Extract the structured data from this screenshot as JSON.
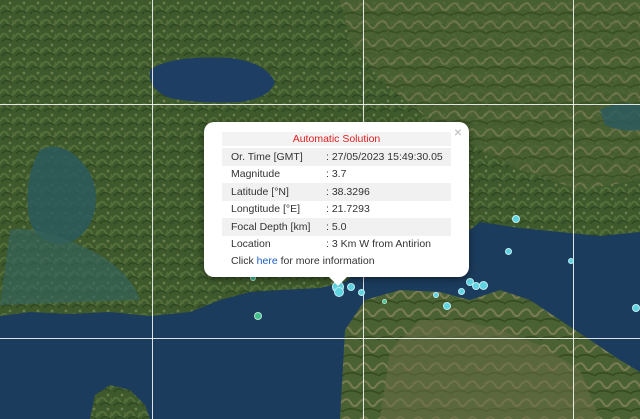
{
  "popup": {
    "title": "Automatic Solution",
    "close_symbol": "×",
    "rows": [
      {
        "label": "Or. Time [GMT]",
        "value": ": 27/05/2023 15:49:30.05"
      },
      {
        "label": "Magnitude",
        "value": ": 3.7"
      },
      {
        "label": "Latitude [°N]",
        "value": ": 38.3296"
      },
      {
        "label": "Longtitude [°E]",
        "value": ": 21.7293"
      },
      {
        "label": "Focal Depth [km]",
        "value": ": 5.0"
      },
      {
        "label": "Location",
        "value": ": 3 Km W from Antirion"
      }
    ],
    "more_prefix": "Click ",
    "more_link": "here",
    "more_suffix": " for more information"
  },
  "colors": {
    "title": "#e02020",
    "link": "#1a5fc8",
    "marker_cyan": "#5fd3e0",
    "marker_green": "#3fbf8a",
    "sea": "#1b3a5a"
  }
}
